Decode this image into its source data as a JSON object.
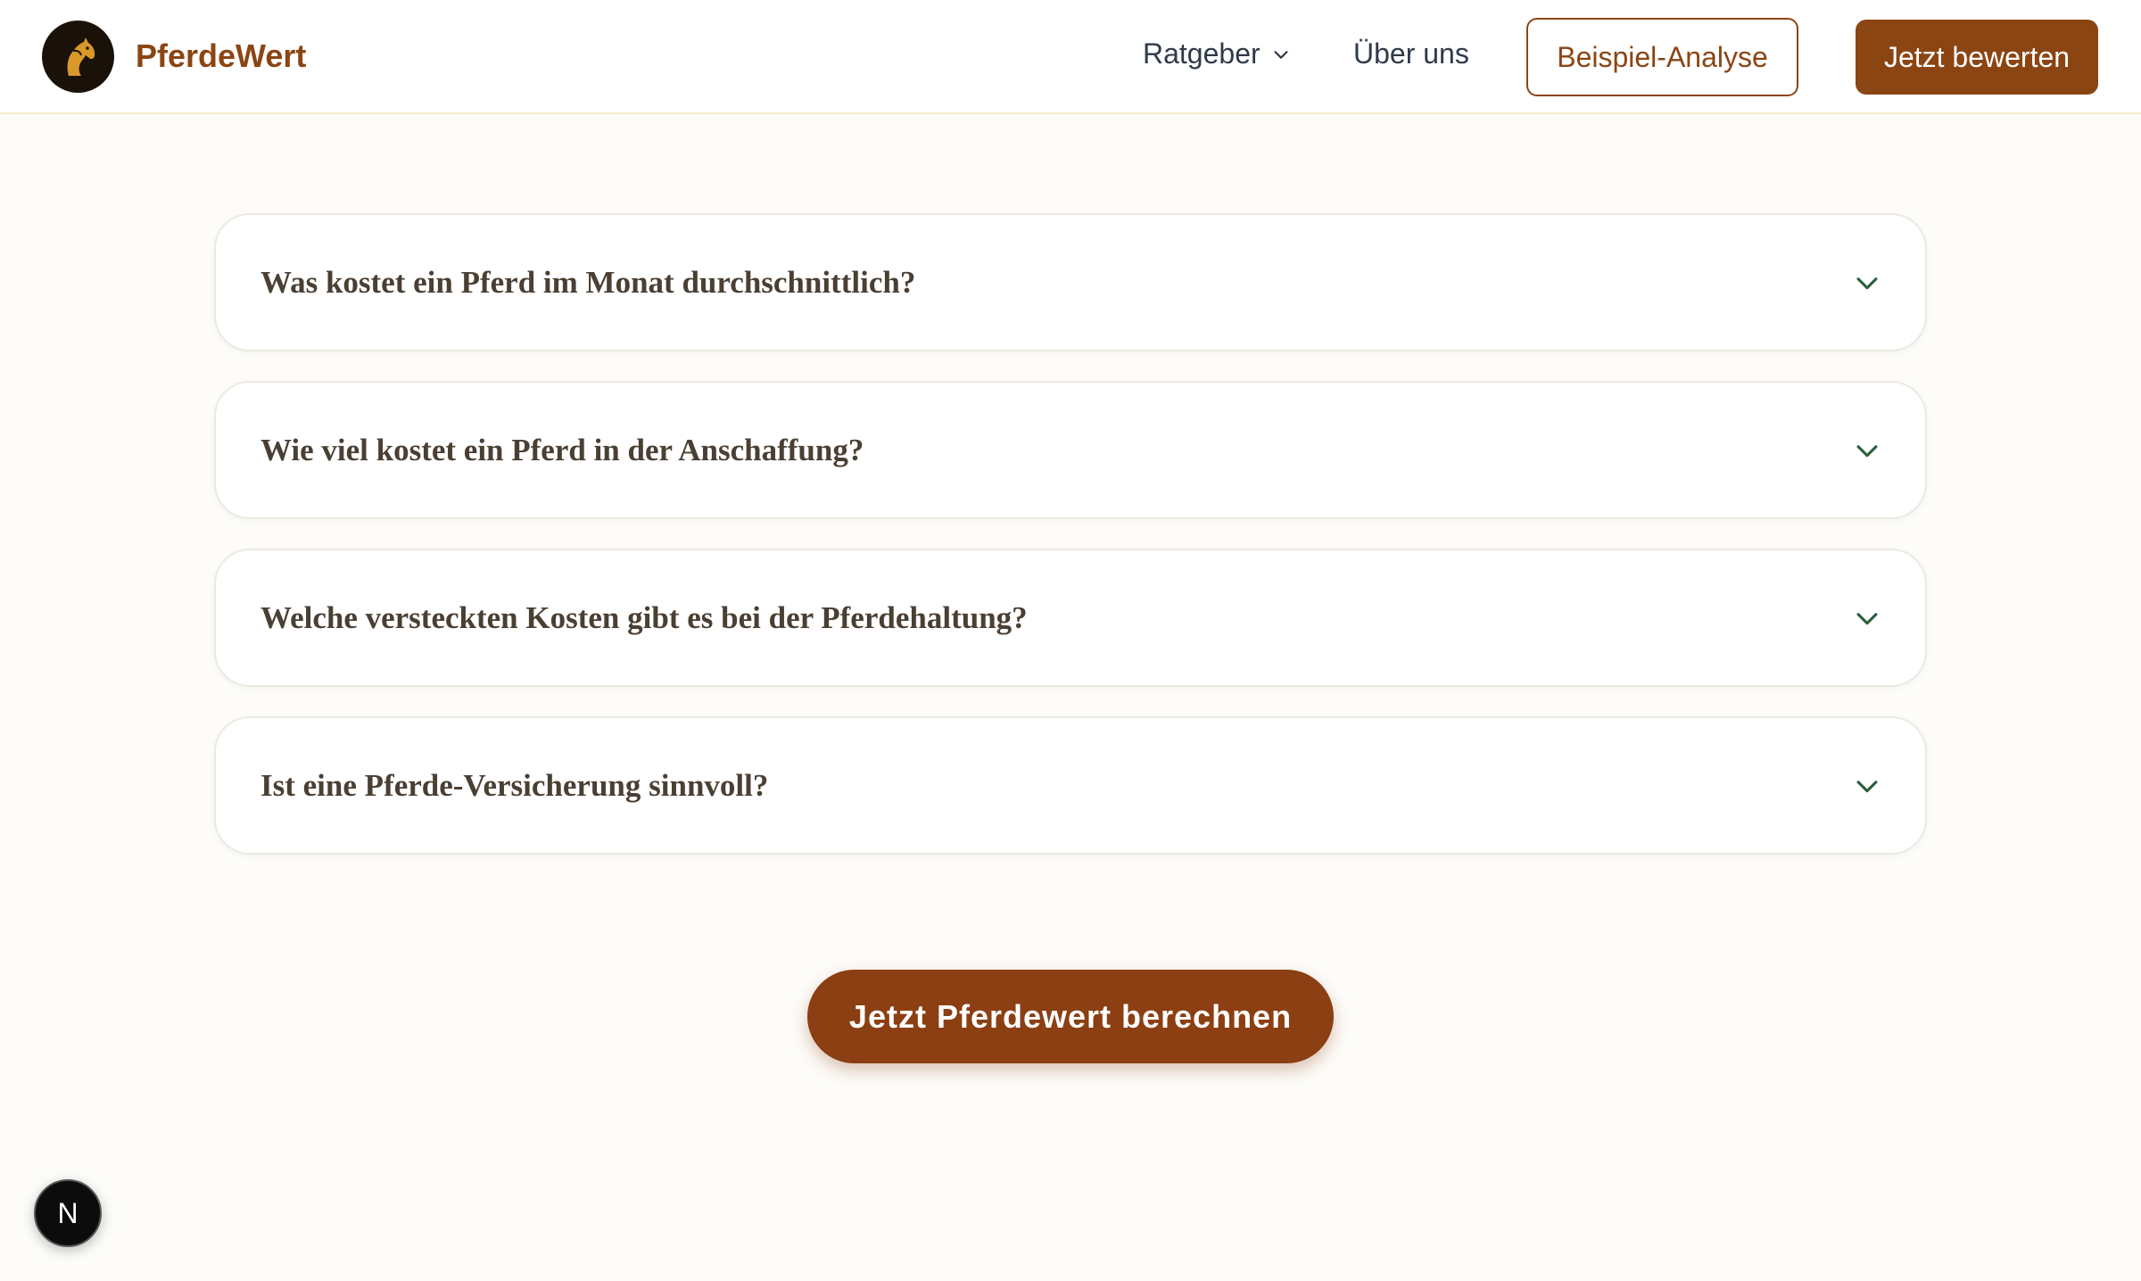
{
  "header": {
    "brand": "PferdeWert",
    "nav": {
      "ratgeber": "Ratgeber",
      "ueber_uns": "Über uns"
    },
    "buttons": {
      "beispiel": "Beispiel-Analyse",
      "bewerten": "Jetzt bewerten"
    }
  },
  "faq": {
    "items": [
      {
        "question": "Was kostet ein Pferd im Monat durchschnittlich?"
      },
      {
        "question": "Wie viel kostet ein Pferd in der Anschaffung?"
      },
      {
        "question": "Welche versteckten Kosten gibt es bei der Pferdehaltung?"
      },
      {
        "question": "Ist eine Pferde-Versicherung sinnvoll?"
      }
    ]
  },
  "cta": {
    "label": "Jetzt Pferdewert berechnen"
  },
  "dev_badge": {
    "label": "N"
  },
  "icons": {
    "logo": "horse-head-icon",
    "dropdown": "chevron-down-icon",
    "faq_toggle": "chevron-down-icon"
  },
  "colors": {
    "brand": "#8b4513",
    "cta": "#8b3f12",
    "chevron": "#2f5d3a",
    "background": "#fdfcf9"
  }
}
